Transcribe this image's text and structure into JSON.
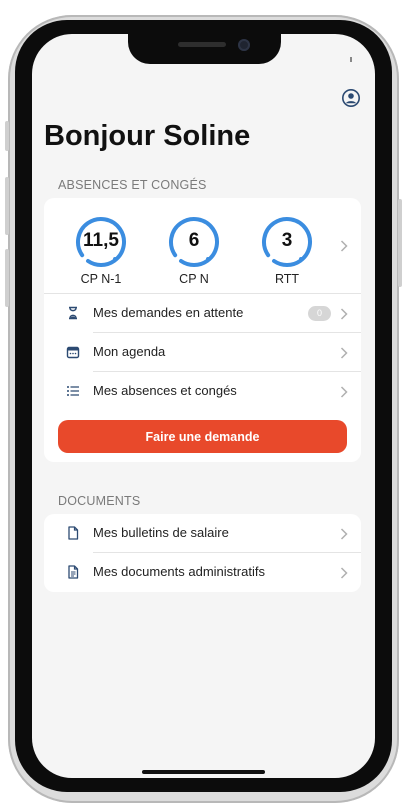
{
  "header": {
    "greeting": "Bonjour Soline",
    "profile_icon": "user-circle-icon"
  },
  "absences": {
    "section_title": "ABSENCES ET CONGÉS",
    "counters": [
      {
        "value": "11,5",
        "label": "CP N-1"
      },
      {
        "value": "6",
        "label": "CP N"
      },
      {
        "value": "3",
        "label": "RTT"
      }
    ],
    "items": [
      {
        "label": "Mes demandes en attente",
        "icon": "hourglass-icon",
        "badge": "0"
      },
      {
        "label": "Mon agenda",
        "icon": "calendar-icon"
      },
      {
        "label": "Mes absences et congés",
        "icon": "list-icon"
      }
    ],
    "cta_label": "Faire une demande"
  },
  "documents": {
    "section_title": "DOCUMENTS",
    "items": [
      {
        "label": "Mes bulletins de salaire",
        "icon": "document-icon"
      },
      {
        "label": "Mes documents administratifs",
        "icon": "document-text-icon"
      }
    ]
  },
  "colors": {
    "accent": "#e8492b",
    "gauge": "#3b8de0",
    "icon_blue": "#2c4a72"
  }
}
